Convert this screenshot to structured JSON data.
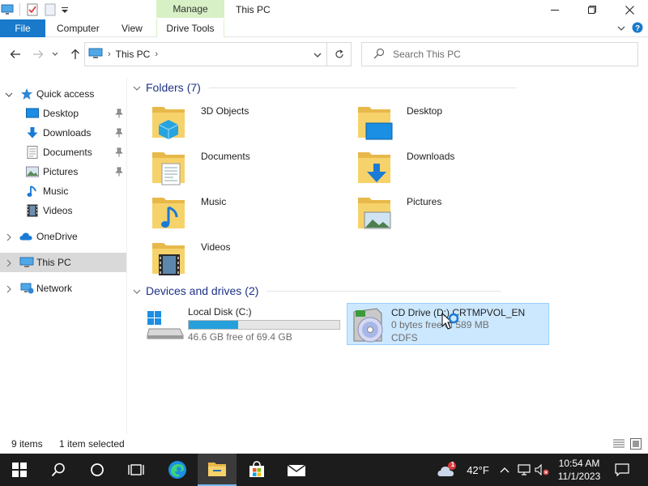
{
  "window": {
    "title": "This PC",
    "contextual_tab_group": "Manage"
  },
  "ribbon": {
    "tabs": [
      {
        "label": "File"
      },
      {
        "label": "Computer"
      },
      {
        "label": "View"
      },
      {
        "label": "Drive Tools"
      }
    ]
  },
  "address": {
    "crumbs": [
      "This PC"
    ],
    "search_placeholder": "Search This PC"
  },
  "navigation": {
    "quick_access": "Quick access",
    "quick_items": [
      {
        "label": "Desktop",
        "icon": "desktop-icon",
        "pinned": true
      },
      {
        "label": "Downloads",
        "icon": "downloads-icon",
        "pinned": true
      },
      {
        "label": "Documents",
        "icon": "documents-icon",
        "pinned": true
      },
      {
        "label": "Pictures",
        "icon": "pictures-icon",
        "pinned": true
      },
      {
        "label": "Music",
        "icon": "music-icon",
        "pinned": false
      },
      {
        "label": "Videos",
        "icon": "videos-icon",
        "pinned": false
      }
    ],
    "onedrive": "OneDrive",
    "this_pc": "This PC",
    "network": "Network"
  },
  "folders": {
    "header": "Folders",
    "count": "(7)",
    "items": [
      {
        "label": "3D Objects"
      },
      {
        "label": "Desktop"
      },
      {
        "label": "Documents"
      },
      {
        "label": "Downloads"
      },
      {
        "label": "Music"
      },
      {
        "label": "Pictures"
      },
      {
        "label": "Videos"
      }
    ]
  },
  "drives": {
    "header": "Devices and drives",
    "count": "(2)",
    "items": [
      {
        "name": "Local Disk (C:)",
        "free_text": "46.6 GB free of 69.4 GB",
        "used_fraction": 0.33
      },
      {
        "name": "CD Drive (D:) CRTMPVOL_EN",
        "free_text": "0 bytes free of 589 MB",
        "fs": "CDFS"
      }
    ]
  },
  "status": {
    "items_count": "9 items",
    "selected": "1 item selected"
  },
  "taskbar": {
    "weather_temp": "42°F",
    "weather_badge": "1",
    "time": "10:54 AM",
    "date": "11/1/2023"
  },
  "colors": {
    "accent": "#1979ca",
    "selection": "#cce8ff",
    "drive_bar": "#26a0da",
    "group_header": "#1e3287",
    "taskbar": "#1c1c1c"
  }
}
